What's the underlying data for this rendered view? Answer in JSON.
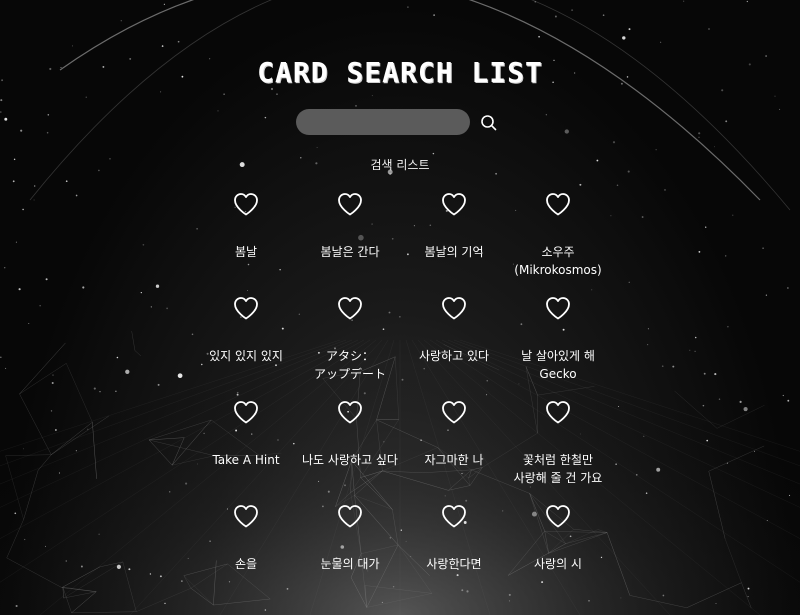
{
  "header": {
    "title": "CARD SEARCH LIST"
  },
  "search": {
    "placeholder": "",
    "value": "",
    "icon": "search-icon"
  },
  "list": {
    "label": "검색 리스트",
    "cards": [
      {
        "title": "봄날",
        "icon": "heart-icon"
      },
      {
        "title": "봄날은 간다",
        "icon": "heart-icon"
      },
      {
        "title": "봄날의 기억",
        "icon": "heart-icon"
      },
      {
        "title": "소우주 (Mikrokosmos)",
        "icon": "heart-icon"
      },
      {
        "title": "있지 있지 있지",
        "icon": "heart-icon"
      },
      {
        "title": "アタシ：アップデート",
        "icon": "heart-icon"
      },
      {
        "title": "사랑하고 있다",
        "icon": "heart-icon"
      },
      {
        "title": "날 살아있게 해 Gecko",
        "icon": "heart-icon"
      },
      {
        "title": "Take A Hint",
        "icon": "heart-icon"
      },
      {
        "title": "나도 사랑하고 싶다",
        "icon": "heart-icon"
      },
      {
        "title": "자그마한 나",
        "icon": "heart-icon"
      },
      {
        "title": "꽃처럼 한철만 사랑해 줄 건 가요",
        "icon": "heart-icon"
      },
      {
        "title": "손을",
        "icon": "heart-icon"
      },
      {
        "title": "눈물의 대가",
        "icon": "heart-icon"
      },
      {
        "title": "사랑한다면",
        "icon": "heart-icon"
      },
      {
        "title": "사랑의 시",
        "icon": "heart-icon"
      }
    ]
  },
  "colors": {
    "background": "#050505",
    "text": "#ffffff",
    "search_field": "#5b5b5b"
  }
}
